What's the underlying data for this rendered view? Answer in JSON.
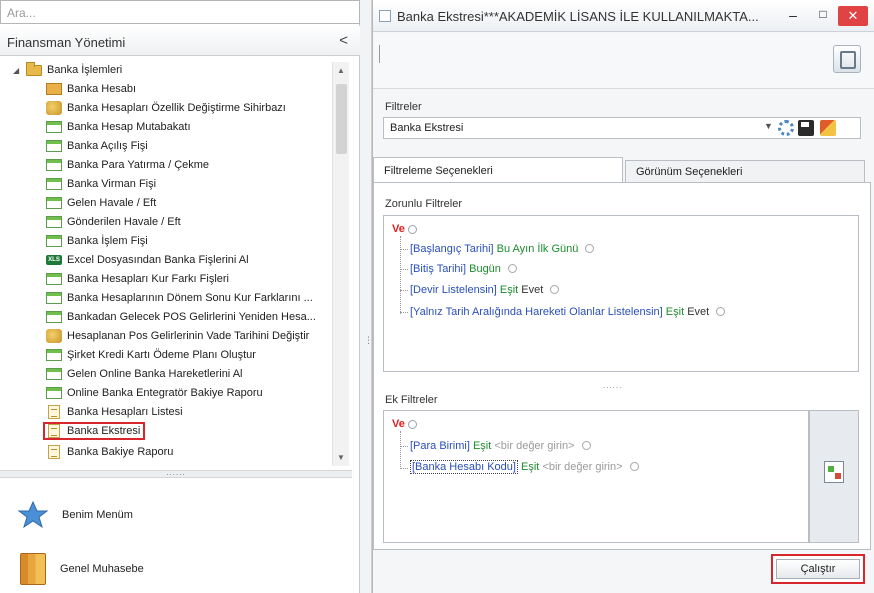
{
  "left_panel": {
    "search_placeholder": "Ara...",
    "section_title": "Finansman Yönetimi",
    "collapse_glyph": "<",
    "tree": {
      "root": "Banka İşlemleri",
      "items": [
        {
          "label": "Banka Hesabı",
          "icon": "account-icon"
        },
        {
          "label": "Banka Hesapları Özellik Değiştirme Sihirbazı",
          "icon": "wizard-icon"
        },
        {
          "label": "Banka Hesap Mutabakatı",
          "icon": "form-icon"
        },
        {
          "label": "Banka Açılış Fişi",
          "icon": "form-icon"
        },
        {
          "label": "Banka Para Yatırma / Çekme",
          "icon": "form-icon"
        },
        {
          "label": "Banka Virman Fişi",
          "icon": "form-icon"
        },
        {
          "label": "Gelen Havale / Eft",
          "icon": "form-icon"
        },
        {
          "label": "Gönderilen Havale / Eft",
          "icon": "form-icon"
        },
        {
          "label": "Banka İşlem Fişi",
          "icon": "form-icon"
        },
        {
          "label": "Excel Dosyasından Banka Fişlerini Al",
          "icon": "excel-icon"
        },
        {
          "label": "Banka Hesapları Kur Farkı Fişleri",
          "icon": "form-icon"
        },
        {
          "label": "Banka Hesaplarının Dönem Sonu Kur Farklarını ...",
          "icon": "form-icon"
        },
        {
          "label": "Bankadan Gelecek POS Gelirlerini Yeniden Hesa...",
          "icon": "form-icon"
        },
        {
          "label": "Hesaplanan Pos Gelirlerinin Vade Tarihini Değiştir",
          "icon": "wizard-icon"
        },
        {
          "label": "Şirket Kredi Kartı Ödeme Planı Oluştur",
          "icon": "form-icon"
        },
        {
          "label": "Gelen Online Banka Hareketlerini Al",
          "icon": "form-icon"
        },
        {
          "label": "Online Banka Entegratör Bakiye Raporu",
          "icon": "form-icon"
        },
        {
          "label": "Banka Hesapları Listesi",
          "icon": "list-icon"
        },
        {
          "label": "Banka Ekstresi",
          "icon": "list-icon",
          "selected": true
        },
        {
          "label": "Banka Bakiye Raporu",
          "icon": "list-icon"
        }
      ]
    },
    "splitter_dots": "......",
    "bottom_items": [
      {
        "label": "Benim Menüm",
        "icon": "star-icon"
      },
      {
        "label": "Genel Muhasebe",
        "icon": "books-icon"
      }
    ]
  },
  "window": {
    "title": "Banka Ekstresi***AKADEMİK LİSANS İLE KULLANILMAKTA...",
    "min_glyph": "–",
    "max_glyph": "□",
    "close_glyph": "✕"
  },
  "filters": {
    "label": "Filtreler",
    "selected": "Banka Ekstresi",
    "tabs": [
      "Filtreleme Seçenekleri",
      "Görünüm Seçenekleri"
    ],
    "mandatory_label": "Zorunlu Filtreler",
    "extra_label": "Ek Filtreler",
    "operator": "Ve",
    "mandatory": [
      {
        "field": "[Başlangıç Tarihi]",
        "op": "Bu Ayın İlk Günü",
        "value": ""
      },
      {
        "field": "[Bitiş Tarihi]",
        "op": "Bugün",
        "value": ""
      },
      {
        "field": "[Devir Listelensin]",
        "op": "Eşit",
        "value": "Evet"
      },
      {
        "field": "[Yalnız Tarih Aralığında Hareketi Olanlar Listelensin]",
        "op": "Eşit",
        "value": "Evet"
      }
    ],
    "extra": [
      {
        "field": "[Para Birimi]",
        "op": "Eşit",
        "placeholder": "<bir değer girin>"
      },
      {
        "field": "[Banka Hesabı Kodu]",
        "op": "Eşit",
        "placeholder": "<bir değer girin>"
      }
    ],
    "divider_dots": "......",
    "run_label": "Çalıştır"
  },
  "colors": {
    "highlight_red": "#d9262c",
    "field_blue": "#2a4fb8",
    "op_green": "#1c8c2e",
    "ve_red": "#dd2222",
    "close_red": "#e04343"
  }
}
